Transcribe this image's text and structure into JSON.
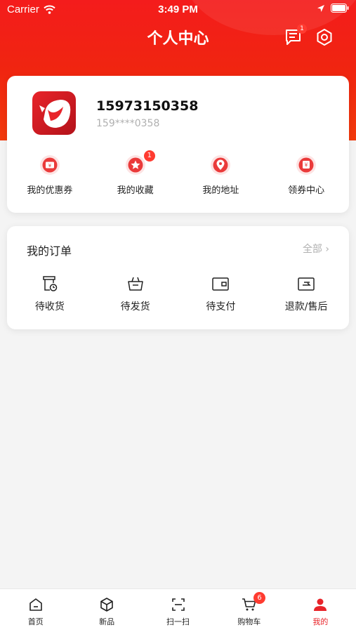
{
  "status_bar": {
    "carrier": "Carrier",
    "time": "3:49 PM"
  },
  "nav": {
    "title": "个人中心",
    "message_badge": "1"
  },
  "profile": {
    "name": "15973150358",
    "masked_phone": "159****0358"
  },
  "quick_actions": [
    {
      "label": "我的优惠券",
      "icon": "coupon-icon",
      "badge": ""
    },
    {
      "label": "我的收藏",
      "icon": "star-icon",
      "badge": "1"
    },
    {
      "label": "我的地址",
      "icon": "location-pin-icon",
      "badge": ""
    },
    {
      "label": "领券中心",
      "icon": "yen-voucher-icon",
      "badge": ""
    }
  ],
  "orders": {
    "title": "我的订单",
    "all_label": "全部",
    "items": [
      {
        "label": "待收货",
        "icon": "receive-icon"
      },
      {
        "label": "待发货",
        "icon": "basket-icon"
      },
      {
        "label": "待支付",
        "icon": "wallet-icon"
      },
      {
        "label": "退款/售后",
        "icon": "refund-icon"
      }
    ]
  },
  "tabbar": {
    "items": [
      {
        "label": "首页",
        "icon": "home-icon"
      },
      {
        "label": "新品",
        "icon": "box-icon"
      },
      {
        "label": "扫一扫",
        "icon": "scan-icon"
      },
      {
        "label": "购物车",
        "icon": "cart-icon",
        "badge": "6"
      },
      {
        "label": "我的",
        "icon": "profile-icon"
      }
    ]
  },
  "colors": {
    "brand_red": "#e8242a",
    "badge_red": "#ff3b30",
    "header_red": "#f41c1c"
  }
}
